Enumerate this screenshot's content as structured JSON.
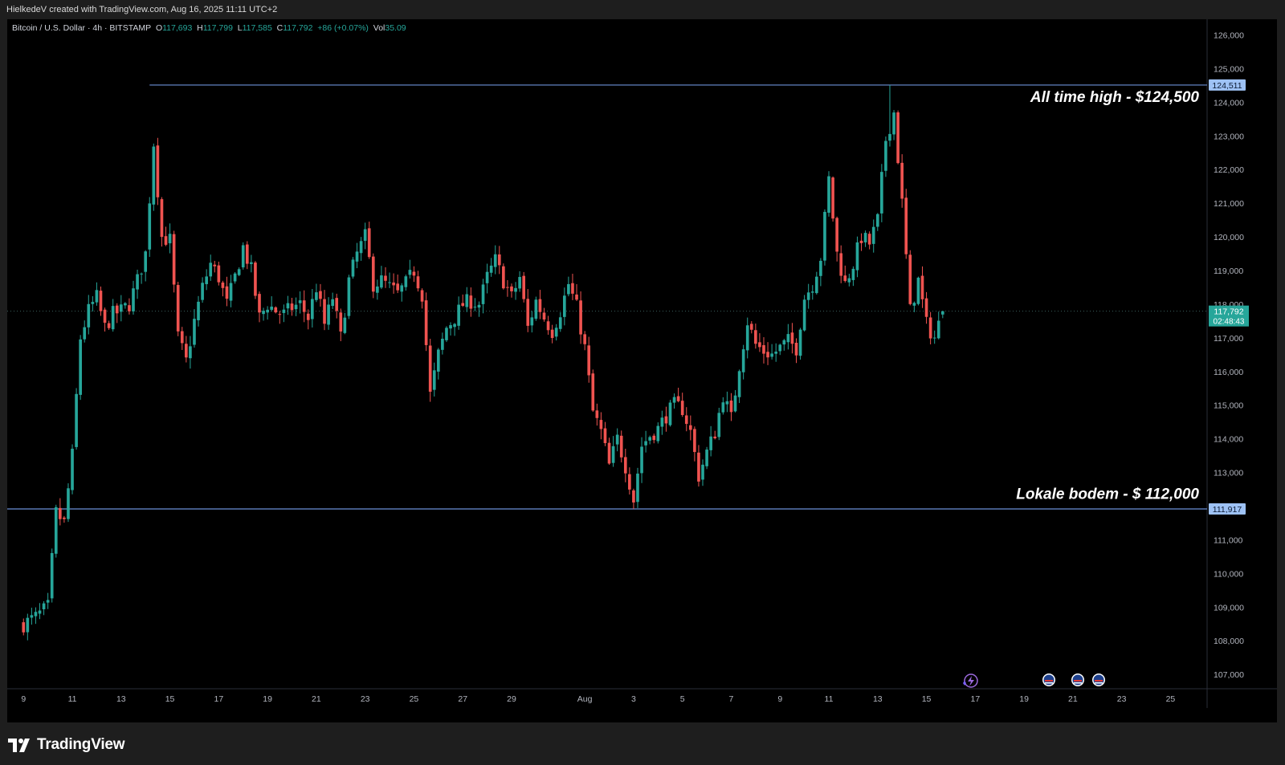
{
  "header": {
    "created_text": "HielkedeV created with TradingView.com, Aug 16, 2025 11:11 UTC+2"
  },
  "legend": {
    "symbol": "Bitcoin / U.S. Dollar · 4h · BITSTAMP",
    "o_label": "O",
    "o_value": "117,693",
    "h_label": "H",
    "h_value": "117,799",
    "l_label": "L",
    "l_value": "117,585",
    "c_label": "C",
    "c_value": "117,792",
    "change": "+86 (+0.07%)",
    "vol_label": "Vol",
    "vol_value": "35.09"
  },
  "annotations": {
    "ath_text": "All time high - $124,500",
    "low_text": "Lokale bodem - $ 112,000"
  },
  "price_tags": {
    "ath_tag": "124,511",
    "low_tag": "111,917",
    "last_price": "117,792",
    "countdown": "02:48:43"
  },
  "brand": {
    "name": "TradingView"
  },
  "colors": {
    "up": "#26a69a",
    "down": "#ef5350",
    "level_line": "#6b8fd6",
    "tag_bg": "#9ec2f5",
    "last_bg": "#26a69a",
    "background": "#000000"
  },
  "chart_data": {
    "type": "candlestick",
    "title": "Bitcoin / U.S. Dollar · 4h · BITSTAMP",
    "y_range": [
      106500,
      126300
    ],
    "y_ticks": [
      107000,
      108000,
      109000,
      110000,
      111000,
      112000,
      113000,
      114000,
      115000,
      116000,
      117000,
      118000,
      119000,
      120000,
      121000,
      122000,
      123000,
      124000,
      125000,
      126000
    ],
    "y_tick_labels": [
      "107,000",
      "108,000",
      "109,000",
      "110,000",
      "111,000",
      "112,000",
      "113,000",
      "114,000",
      "115,000",
      "116,000",
      "117,000",
      "118,000",
      "119,000",
      "120,000",
      "121,000",
      "122,000",
      "123,000",
      "124,000",
      "125,000",
      "126,000"
    ],
    "x_ticks": [
      {
        "label": "9",
        "t": 0
      },
      {
        "label": "11",
        "t": 12
      },
      {
        "label": "13",
        "t": 24
      },
      {
        "label": "15",
        "t": 36
      },
      {
        "label": "17",
        "t": 48
      },
      {
        "label": "19",
        "t": 60
      },
      {
        "label": "21",
        "t": 72
      },
      {
        "label": "23",
        "t": 84
      },
      {
        "label": "25",
        "t": 96
      },
      {
        "label": "27",
        "t": 108
      },
      {
        "label": "29",
        "t": 120
      },
      {
        "label": "Aug",
        "t": 138
      },
      {
        "label": "3",
        "t": 150
      },
      {
        "label": "5",
        "t": 162
      },
      {
        "label": "7",
        "t": 174
      },
      {
        "label": "9",
        "t": 186
      },
      {
        "label": "11",
        "t": 198
      },
      {
        "label": "13",
        "t": 210
      },
      {
        "label": "15",
        "t": 222
      },
      {
        "label": "17",
        "t": 234
      },
      {
        "label": "19",
        "t": 246
      },
      {
        "label": "21",
        "t": 258
      },
      {
        "label": "23",
        "t": 270
      },
      {
        "label": "25",
        "t": 282
      }
    ],
    "x_range": [
      -4,
      291
    ],
    "horizontal_levels": [
      {
        "value": 124511,
        "label": "All time high - $124,500",
        "start_t": 31
      },
      {
        "value": 111917,
        "label": "Lokale bodem - $ 112,000",
        "start_t": -4
      }
    ],
    "last_price": 117792,
    "waypoints": [
      [
        0,
        108500
      ],
      [
        3,
        108700
      ],
      [
        6,
        109000
      ],
      [
        8,
        111800
      ],
      [
        10,
        111500
      ],
      [
        12,
        113500
      ],
      [
        14,
        117000
      ],
      [
        16,
        117800
      ],
      [
        18,
        118200
      ],
      [
        20,
        117300
      ],
      [
        22,
        117700
      ],
      [
        24,
        117800
      ],
      [
        26,
        118000
      ],
      [
        28,
        118700
      ],
      [
        30,
        119500
      ],
      [
        32,
        122800
      ],
      [
        34,
        120000
      ],
      [
        36,
        119900
      ],
      [
        38,
        117000
      ],
      [
        40,
        116300
      ],
      [
        42,
        117500
      ],
      [
        44,
        118500
      ],
      [
        46,
        119200
      ],
      [
        48,
        118800
      ],
      [
        50,
        118000
      ],
      [
        52,
        118800
      ],
      [
        54,
        119700
      ],
      [
        56,
        119000
      ],
      [
        58,
        117600
      ],
      [
        60,
        118000
      ],
      [
        62,
        117800
      ],
      [
        64,
        117700
      ],
      [
        66,
        117900
      ],
      [
        68,
        118000
      ],
      [
        70,
        117600
      ],
      [
        72,
        118500
      ],
      [
        74,
        117400
      ],
      [
        76,
        118200
      ],
      [
        78,
        117000
      ],
      [
        80,
        118700
      ],
      [
        82,
        119500
      ],
      [
        84,
        120000
      ],
      [
        86,
        118600
      ],
      [
        88,
        118700
      ],
      [
        90,
        118500
      ],
      [
        92,
        118300
      ],
      [
        94,
        118600
      ],
      [
        96,
        119000
      ],
      [
        98,
        118300
      ],
      [
        100,
        115300
      ],
      [
        102,
        116500
      ],
      [
        104,
        117300
      ],
      [
        106,
        117600
      ],
      [
        108,
        118000
      ],
      [
        110,
        118100
      ],
      [
        112,
        118000
      ],
      [
        114,
        118800
      ],
      [
        116,
        119300
      ],
      [
        118,
        118700
      ],
      [
        120,
        118200
      ],
      [
        122,
        118800
      ],
      [
        124,
        117300
      ],
      [
        126,
        118100
      ],
      [
        128,
        117600
      ],
      [
        130,
        117200
      ],
      [
        132,
        117800
      ],
      [
        134,
        118600
      ],
      [
        136,
        117900
      ],
      [
        138,
        116700
      ],
      [
        140,
        114800
      ],
      [
        142,
        114200
      ],
      [
        144,
        113200
      ],
      [
        146,
        114000
      ],
      [
        148,
        113200
      ],
      [
        150,
        112200
      ],
      [
        152,
        113800
      ],
      [
        154,
        114100
      ],
      [
        156,
        114300
      ],
      [
        158,
        114700
      ],
      [
        160,
        115000
      ],
      [
        162,
        114900
      ],
      [
        164,
        114200
      ],
      [
        166,
        112900
      ],
      [
        168,
        113600
      ],
      [
        170,
        114200
      ],
      [
        172,
        115300
      ],
      [
        174,
        114600
      ],
      [
        176,
        116200
      ],
      [
        178,
        117500
      ],
      [
        180,
        116800
      ],
      [
        182,
        116600
      ],
      [
        184,
        116500
      ],
      [
        186,
        116700
      ],
      [
        188,
        116900
      ],
      [
        190,
        116700
      ],
      [
        192,
        118200
      ],
      [
        194,
        118600
      ],
      [
        196,
        119400
      ],
      [
        198,
        121700
      ],
      [
        200,
        119500
      ],
      [
        202,
        118600
      ],
      [
        204,
        119200
      ],
      [
        206,
        120000
      ],
      [
        208,
        119800
      ],
      [
        210,
        120500
      ],
      [
        212,
        122900
      ],
      [
        214,
        123700
      ],
      [
        216,
        121000
      ],
      [
        218,
        117800
      ],
      [
        220,
        118700
      ],
      [
        222,
        117400
      ],
      [
        224,
        117000
      ],
      [
        226,
        117792
      ]
    ]
  }
}
